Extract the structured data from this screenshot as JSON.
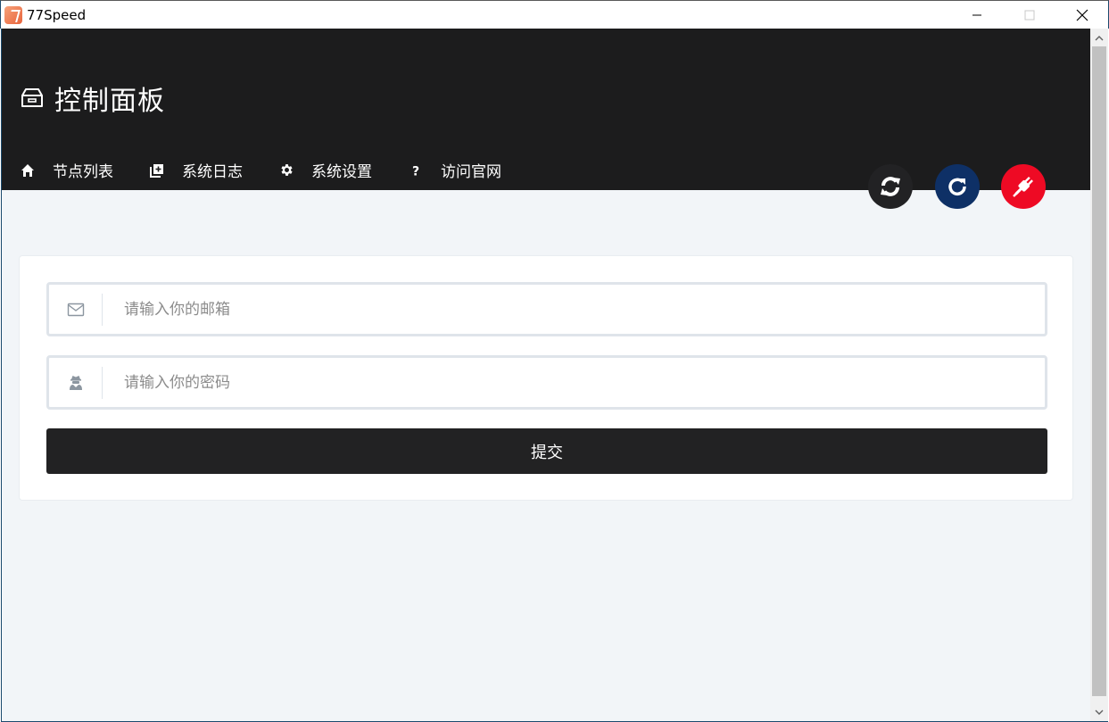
{
  "window": {
    "title": "77Speed"
  },
  "header": {
    "title": "控制面板"
  },
  "nav": {
    "items": [
      {
        "label": "节点列表",
        "icon": "home-icon"
      },
      {
        "label": "系统日志",
        "icon": "log-icon"
      },
      {
        "label": "系统设置",
        "icon": "gear-icon"
      },
      {
        "label": "访问官网",
        "icon": "question-icon"
      }
    ]
  },
  "actions": {
    "sync": {
      "icon": "sync-icon",
      "color": "#222224"
    },
    "refresh": {
      "icon": "refresh-icon",
      "color": "#0e3066"
    },
    "disconnect": {
      "icon": "plug-icon",
      "color": "#ee0a24"
    }
  },
  "form": {
    "email_placeholder": "请输入你的邮箱",
    "password_placeholder": "请输入你的密码",
    "submit_label": "提交"
  },
  "colors": {
    "header_bg": "#1c1c1d",
    "page_bg": "#f2f5f8",
    "button_bg": "#222223"
  }
}
